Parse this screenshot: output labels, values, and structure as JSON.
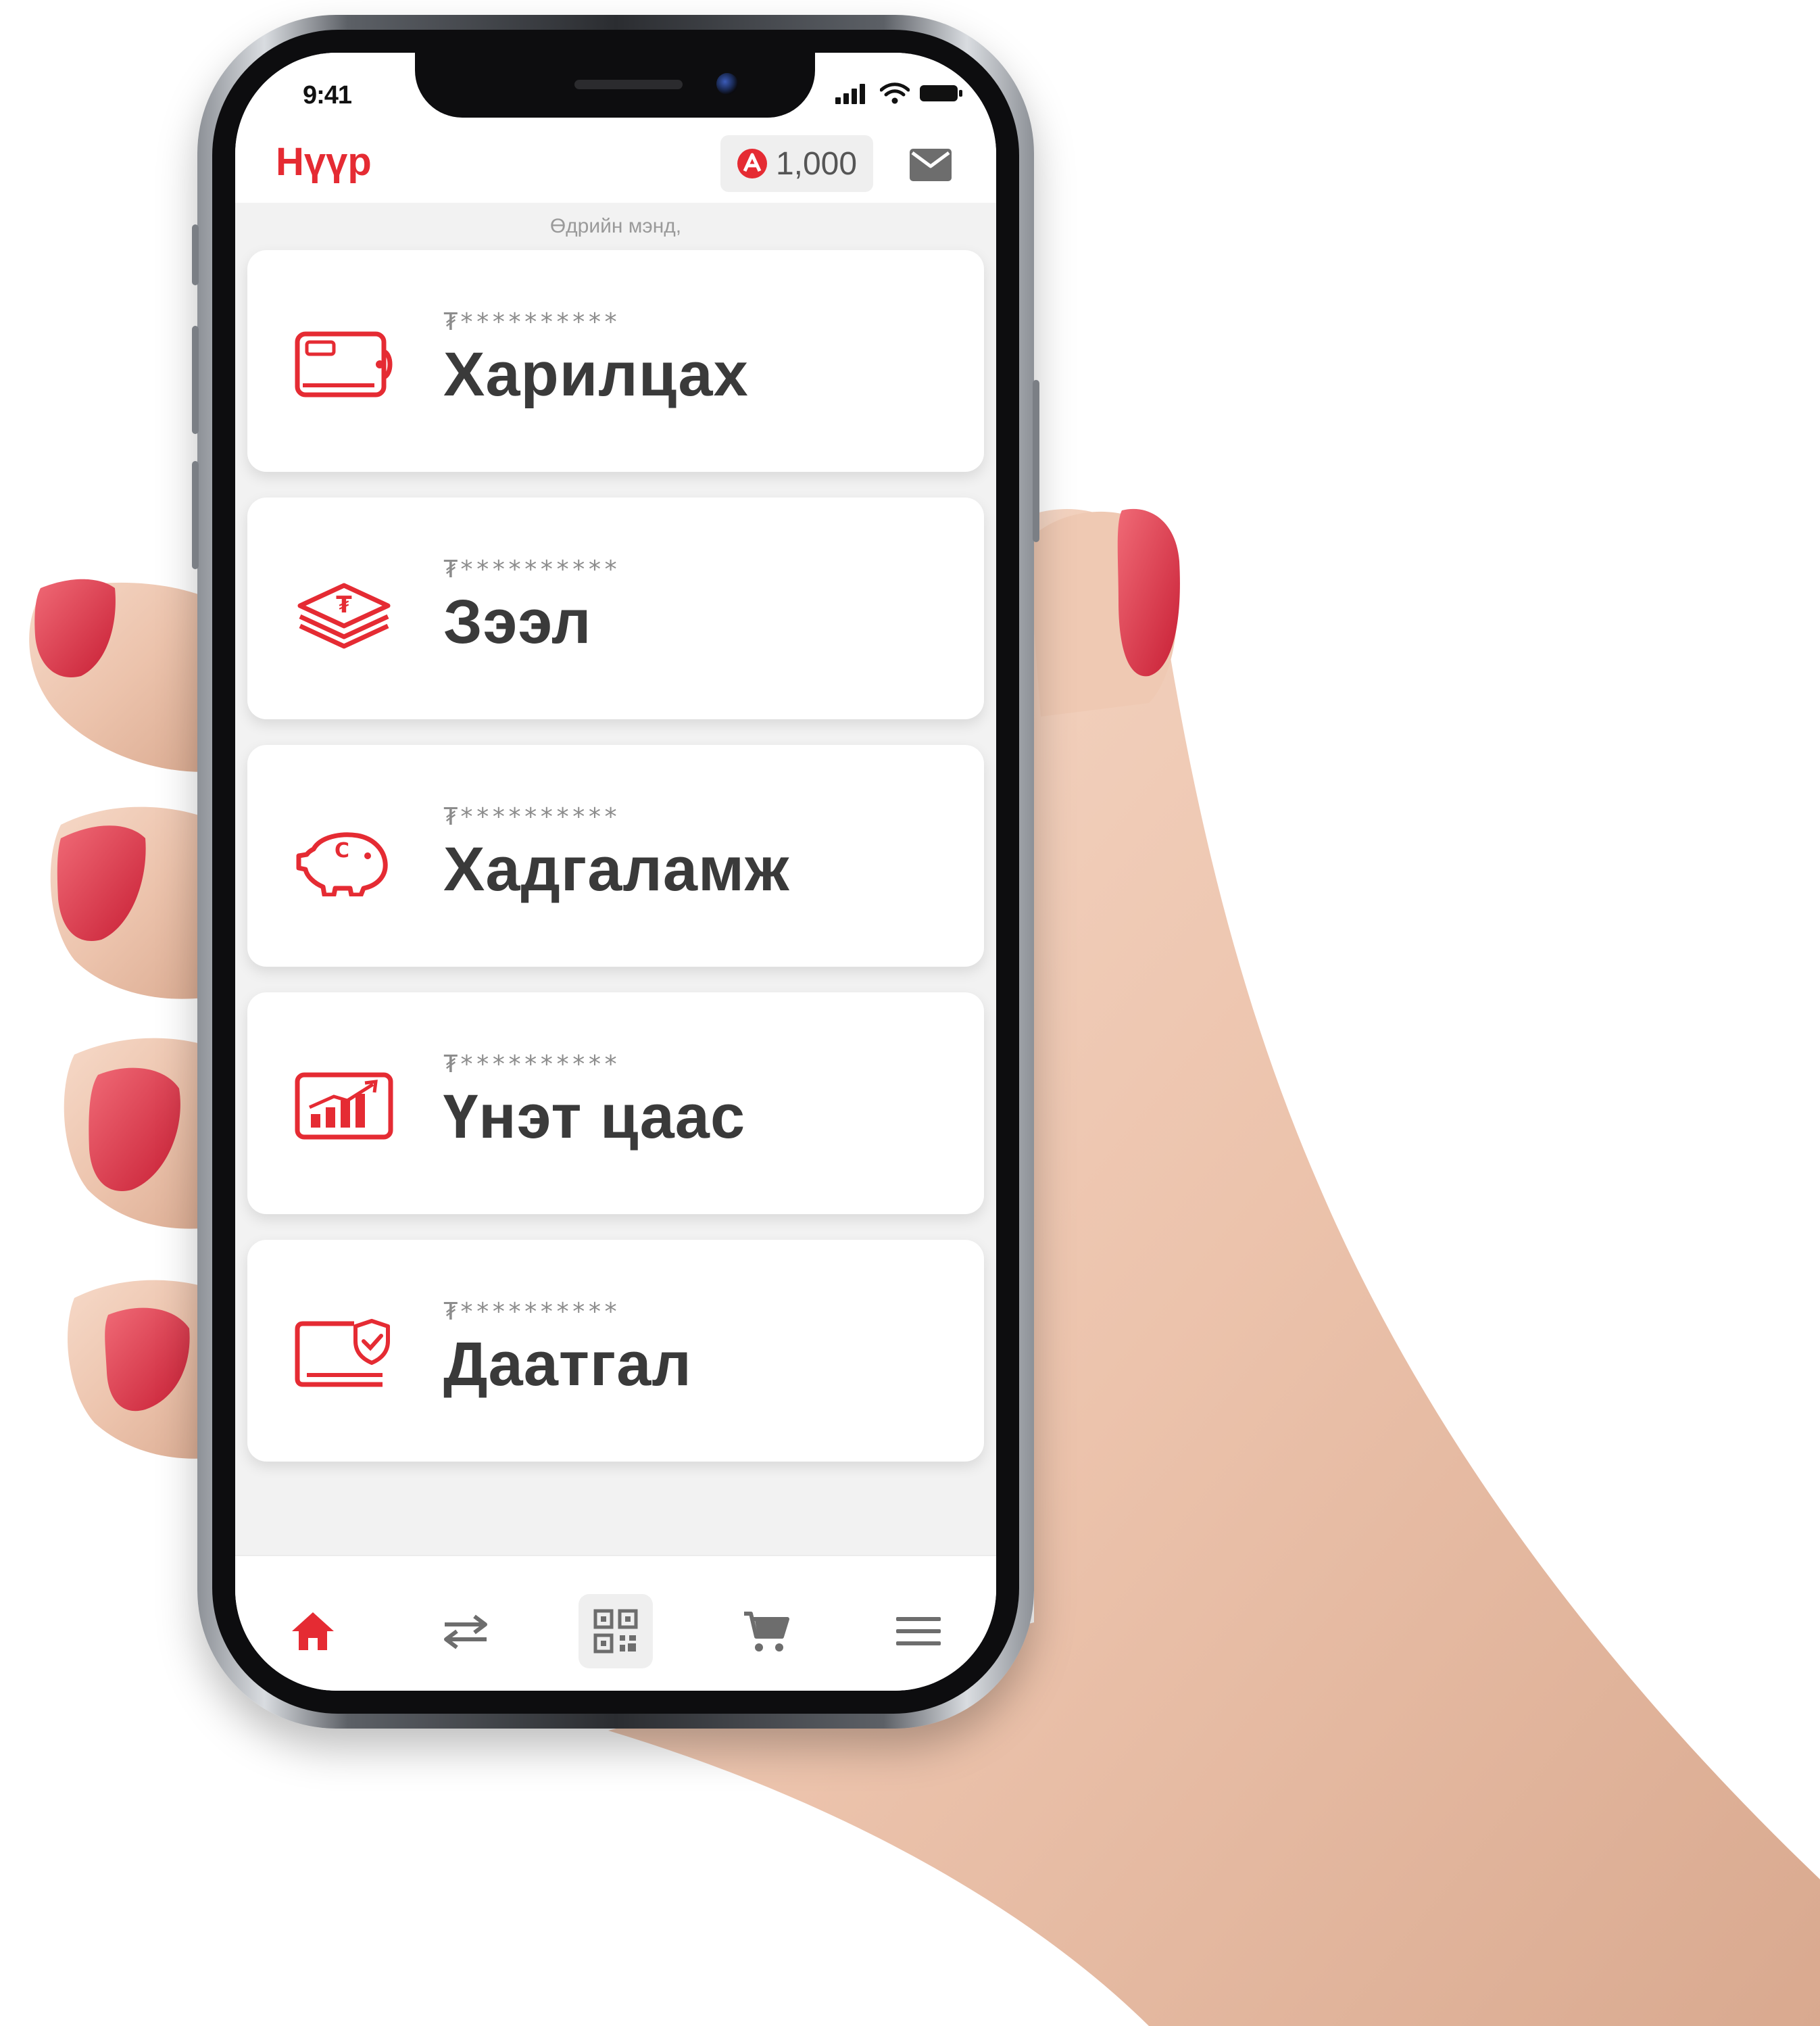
{
  "status_bar": {
    "time": "9:41"
  },
  "header": {
    "title": "Нүүр",
    "points": "1,000"
  },
  "greeting": "Өдрийн мэнд,",
  "accounts": [
    {
      "masked_balance": "₮**********",
      "title": "Харилцах",
      "icon": "wallet-card-icon"
    },
    {
      "masked_balance": "₮**********",
      "title": "Зээл",
      "icon": "money-stack-icon"
    },
    {
      "masked_balance": "₮**********",
      "title": "Хадгаламж",
      "icon": "piggy-bank-icon"
    },
    {
      "masked_balance": "₮**********",
      "title": "Үнэт цаас",
      "icon": "stock-chart-icon"
    },
    {
      "masked_balance": "₮**********",
      "title": "Даатгал",
      "icon": "insurance-shield-icon"
    }
  ],
  "bottom_nav": [
    {
      "name": "home",
      "icon": "home-icon",
      "active": true
    },
    {
      "name": "transfer",
      "icon": "transfer-arrows-icon",
      "active": false
    },
    {
      "name": "qr",
      "icon": "qr-code-icon",
      "active": false
    },
    {
      "name": "cart",
      "icon": "cart-icon",
      "active": false
    },
    {
      "name": "menu",
      "icon": "menu-icon",
      "active": false
    }
  ],
  "colors": {
    "accent": "#e52b33",
    "title_text": "#3a3a3a",
    "muted_text": "#8c8c8c",
    "screen_bg": "#f2f2f2"
  }
}
